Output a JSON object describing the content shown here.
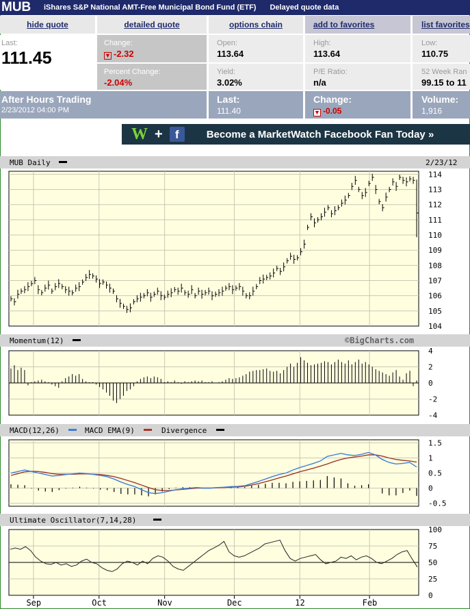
{
  "header": {
    "symbol": "MUB",
    "fund_name": "iShares S&P National AMT-Free Municipal Bond Fund (ETF)",
    "delay_note": "Delayed quote data"
  },
  "nav": {
    "hide_quote": "hide quote",
    "detailed_quote": "detailed quote",
    "options_chain": "options chain",
    "add_favorites": "add to favorites",
    "list_favorites": "list favorites"
  },
  "quote": {
    "last_label": "Last:",
    "last_value": "111.45",
    "change_label": "Change:",
    "change_value": "-2.32",
    "pct_change_label": "Percent Change:",
    "pct_change_value": "-2.04%",
    "open_label": "Open:",
    "open_value": "113.64",
    "yield_label": "Yield:",
    "yield_value": "3.02%",
    "high_label": "High:",
    "high_value": "113.64",
    "pe_label": "P/E Ratio:",
    "pe_value": "n/a",
    "low_label": "Low:",
    "low_value": "110.75",
    "wk52_label": "52 Week Ran",
    "wk52_value": "99.15 to 11"
  },
  "after_hours": {
    "title": "After Hours Trading",
    "timestamp": "2/23/2012 04:00 PM",
    "last_label": "Last:",
    "last_value": "111.40",
    "change_label": "Change:",
    "change_value": "-0.05",
    "volume_label": "Volume:",
    "volume_value": "1,916"
  },
  "banner": {
    "text": "Become a MarketWatch Facebook Fan Today »"
  },
  "colors": {
    "title_bg": "#1f2a6b",
    "chart_bg": "#ffffe0",
    "macd_line": "#3d7fd9",
    "macd_ema": "#a03a2a",
    "down_red": "#cc0000"
  },
  "chart_data": [
    {
      "type": "bar",
      "title": "MUB Daily",
      "date_label": "2/23/12",
      "watermark": "©BigCharts.com",
      "x_ticks": [
        "Sep",
        "Oct",
        "Nov",
        "Dec",
        "12",
        "Feb"
      ],
      "y_ticks": [
        104,
        105,
        106,
        107,
        108,
        109,
        110,
        111,
        112,
        113,
        114
      ],
      "ylim": [
        104,
        114.2
      ],
      "closes": [
        105.8,
        105.6,
        106.1,
        106.3,
        106.4,
        106.6,
        106.8,
        107,
        106.4,
        106.2,
        106.5,
        106.7,
        106.3,
        106.6,
        106.8,
        106.6,
        106.4,
        106.3,
        106.2,
        106.5,
        106.6,
        106.9,
        107.2,
        107.4,
        107.3,
        107.1,
        106.8,
        106.9,
        106.7,
        106.5,
        106.3,
        105.8,
        105.5,
        105.3,
        105.1,
        105.2,
        105.6,
        105.8,
        105.9,
        106.0,
        106.2,
        105.9,
        106.1,
        106.3,
        106.0,
        105.9,
        106.1,
        106.2,
        106.4,
        106.3,
        106.5,
        106.2,
        106.1,
        106.4,
        106.0,
        106.3,
        106.1,
        106.2,
        106.3,
        106.0,
        106.1,
        106.2,
        106.3,
        106.5,
        106.6,
        106.4,
        106.5,
        106.6,
        106.3,
        106.0,
        106.0,
        106.3,
        106.6,
        107.0,
        107.1,
        107.2,
        107.3,
        107.5,
        107.8,
        107.6,
        107.9,
        108.3,
        108.6,
        108.4,
        108.5,
        108.9,
        109.4,
        110.5,
        111.2,
        110.8,
        111.0,
        111.2,
        111.5,
        111.8,
        111.4,
        111.6,
        111.8,
        112.1,
        112.3,
        112.6,
        113.2,
        113.6,
        113.0,
        112.6,
        112.8,
        113.4,
        113.8,
        113.0,
        112.2,
        111.8,
        112.5,
        113.0,
        113.5,
        113.2,
        113.8,
        113.6,
        113.5,
        113.7,
        113.6,
        111.45
      ]
    },
    {
      "type": "bar",
      "title": "Momentum(12)",
      "y_ticks": [
        4,
        2,
        0,
        -2,
        -4
      ],
      "ylim": [
        -4,
        4
      ],
      "values": [
        1.8,
        2.2,
        1.6,
        1.9,
        1.6,
        -0.3,
        0.1,
        0.2,
        0.3,
        0.4,
        0.2,
        0.1,
        -0.2,
        -0.4,
        -0.6,
        0.2,
        0.6,
        0.8,
        1.1,
        0.9,
        1.1,
        0.5,
        0.2,
        0.1,
        0.1,
        -0.2,
        -0.5,
        -0.8,
        -1.2,
        -1.6,
        -2.2,
        -2.5,
        -2.0,
        -1.6,
        -1.0,
        -0.8,
        -0.4,
        0.2,
        0.5,
        0.7,
        0.8,
        0.6,
        0.8,
        0.7,
        0.5,
        0.1,
        0.2,
        0.1,
        0.3,
        0.1,
        -0.1,
        0.2,
        0.1,
        0.2,
        0.3,
        0.2,
        0.3,
        0.1,
        0.1,
        0.2,
        0.0,
        0.1,
        0.2,
        0.4,
        0.6,
        0.5,
        0.6,
        0.7,
        0.9,
        1.1,
        1.4,
        1.5,
        1.6,
        1.6,
        1.7,
        1.8,
        1.5,
        1.4,
        1.5,
        1.2,
        1.6,
        2.0,
        2.4,
        2.0,
        2.5,
        3.2,
        2.8,
        2.5,
        2.2,
        2.3,
        2.4,
        2.5,
        2.7,
        2.6,
        2.3,
        2.6,
        2.9,
        2.6,
        2.4,
        2.8,
        2.3,
        2.6,
        2.9,
        2.4,
        2.6,
        2.3,
        2.0,
        1.7,
        1.5,
        1.3,
        1.1,
        0.9,
        1.3,
        1.6,
        0.8,
        0.4,
        1.2,
        1.5,
        -0.4,
        0.3
      ]
    },
    {
      "type": "line",
      "title": "MACD(12,26)",
      "legend": [
        "MACD EMA(9)",
        "Divergence"
      ],
      "y_ticks": [
        1.5,
        1.0,
        0.5,
        0.0,
        -0.5
      ],
      "ylim": [
        -0.6,
        1.6
      ],
      "macd": [
        0.5,
        0.55,
        0.6,
        0.55,
        0.5,
        0.45,
        0.4,
        0.42,
        0.45,
        0.47,
        0.5,
        0.48,
        0.45,
        0.42,
        0.38,
        0.3,
        0.2,
        0.12,
        0.05,
        -0.05,
        -0.15,
        -0.18,
        -0.15,
        -0.1,
        -0.05,
        -0.02,
        0.0,
        0.02,
        0.0,
        0.0,
        0.02,
        0.03,
        0.05,
        0.06,
        0.08,
        0.15,
        0.22,
        0.3,
        0.38,
        0.45,
        0.5,
        0.6,
        0.68,
        0.75,
        0.82,
        0.9,
        1.05,
        1.1,
        1.15,
        1.1,
        1.08,
        1.12,
        1.18,
        1.1,
        0.95,
        0.85,
        0.8,
        0.82,
        0.85,
        0.7
      ],
      "ema": [
        0.42,
        0.48,
        0.54,
        0.56,
        0.55,
        0.52,
        0.48,
        0.46,
        0.46,
        0.46,
        0.47,
        0.47,
        0.46,
        0.45,
        0.42,
        0.38,
        0.32,
        0.25,
        0.18,
        0.1,
        0.02,
        -0.05,
        -0.08,
        -0.08,
        -0.06,
        -0.04,
        -0.02,
        0.0,
        0.0,
        0.0,
        0.01,
        0.02,
        0.03,
        0.04,
        0.06,
        0.1,
        0.15,
        0.21,
        0.27,
        0.34,
        0.4,
        0.47,
        0.54,
        0.6,
        0.66,
        0.73,
        0.8,
        0.88,
        0.95,
        1.0,
        1.03,
        1.06,
        1.1,
        1.1,
        1.06,
        1.0,
        0.95,
        0.92,
        0.9,
        0.86
      ]
    },
    {
      "type": "line",
      "title": "Ultimate Oscillator(7,14,28)",
      "y_ticks": [
        100,
        75,
        50,
        25,
        0
      ],
      "ylim": [
        0,
        100
      ],
      "values": [
        70,
        72,
        70,
        74,
        68,
        58,
        52,
        48,
        47,
        50,
        46,
        48,
        44,
        46,
        52,
        55,
        50,
        48,
        42,
        38,
        36,
        40,
        48,
        52,
        50,
        46,
        52,
        48,
        56,
        60,
        58,
        52,
        44,
        40,
        38,
        44,
        50,
        56,
        62,
        68,
        72,
        76,
        82,
        66,
        60,
        58,
        60,
        64,
        68,
        72,
        78,
        80,
        82,
        84,
        68,
        56,
        52,
        56,
        58,
        60,
        62,
        54,
        48,
        50,
        52,
        58,
        56,
        60,
        54,
        58,
        60,
        56,
        50,
        48,
        52,
        56,
        62,
        66,
        68,
        55,
        43
      ]
    }
  ]
}
